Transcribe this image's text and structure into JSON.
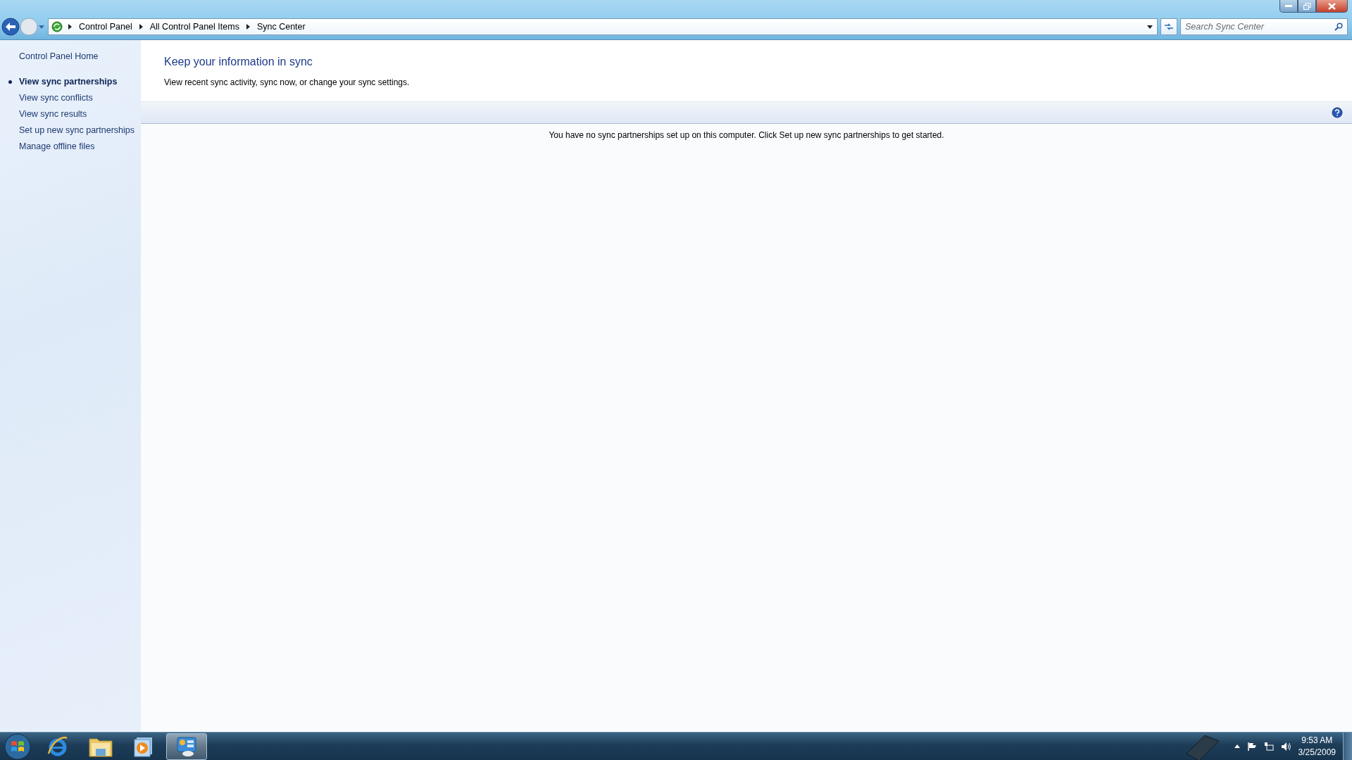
{
  "window": {
    "breadcrumb": [
      "Control Panel",
      "All Control Panel Items",
      "Sync Center"
    ],
    "search": {
      "placeholder": "Search Sync Center"
    }
  },
  "sidebar": {
    "home": "Control Panel Home",
    "items": [
      {
        "label": "View sync partnerships",
        "selected": true
      },
      {
        "label": "View sync conflicts",
        "selected": false
      },
      {
        "label": "View sync results",
        "selected": false
      },
      {
        "label": "Set up new sync partnerships",
        "selected": false
      },
      {
        "label": "Manage offline files",
        "selected": false
      }
    ]
  },
  "content": {
    "title": "Keep your information in sync",
    "description": "View recent sync activity, sync now, or change your sync settings.",
    "message": "You have no sync partnerships set up on this computer. Click Set up new sync partnerships to get started."
  },
  "taskbar": {
    "apps": [
      {
        "kind": "browser",
        "selected": false
      },
      {
        "kind": "folder",
        "selected": false
      },
      {
        "kind": "media",
        "selected": false
      },
      {
        "kind": "control-panel",
        "selected": true
      }
    ],
    "clock": {
      "time": "9:53 AM",
      "date": "3/25/2009"
    }
  }
}
